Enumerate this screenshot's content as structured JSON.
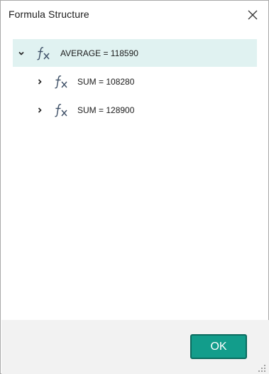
{
  "dialog": {
    "title": "Formula Structure",
    "ok_label": "OK"
  },
  "tree": [
    {
      "label": "AVERAGE = 118590",
      "expanded": true,
      "selected": true,
      "level": 0
    },
    {
      "label": "SUM = 108280",
      "expanded": false,
      "selected": false,
      "level": 1
    },
    {
      "label": "SUM = 128900",
      "expanded": false,
      "selected": false,
      "level": 1
    }
  ],
  "icons": {
    "close": "close-icon",
    "expanded": "chevron-down-icon",
    "collapsed": "chevron-right-icon",
    "function": "function-fx-icon",
    "resize": "resize-grip-icon"
  },
  "colors": {
    "selected_row": "#e0f2f1",
    "ok_button": "#129d8b",
    "ok_border": "#0b6b5f",
    "fx_icon": "#3d4f66",
    "footer": "#f2f2f2"
  }
}
